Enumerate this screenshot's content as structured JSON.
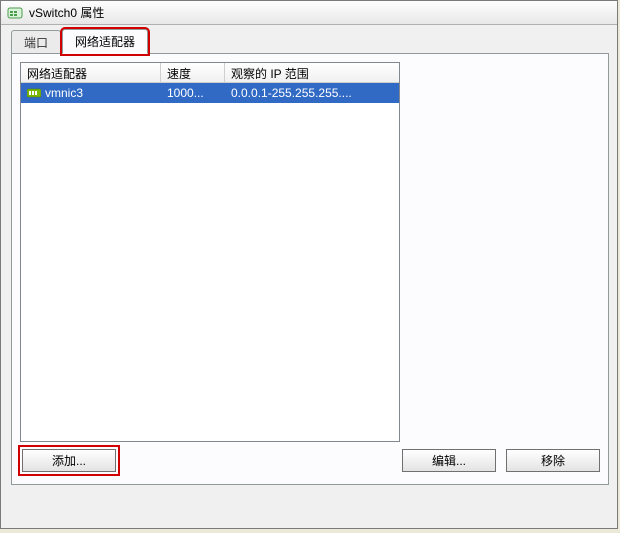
{
  "window": {
    "title": "vSwitch0 属性"
  },
  "tabs": {
    "port": {
      "label": "端口"
    },
    "adapter": {
      "label": "网络适配器"
    }
  },
  "table": {
    "headers": {
      "adapter": "网络适配器",
      "speed": "速度",
      "ip_range": "观察的 IP 范围"
    },
    "rows": [
      {
        "name": "vmnic3",
        "speed": "1000...",
        "ip_range": "0.0.0.1-255.255.255...."
      }
    ]
  },
  "buttons": {
    "add": "添加...",
    "edit": "编辑...",
    "remove": "移除"
  }
}
